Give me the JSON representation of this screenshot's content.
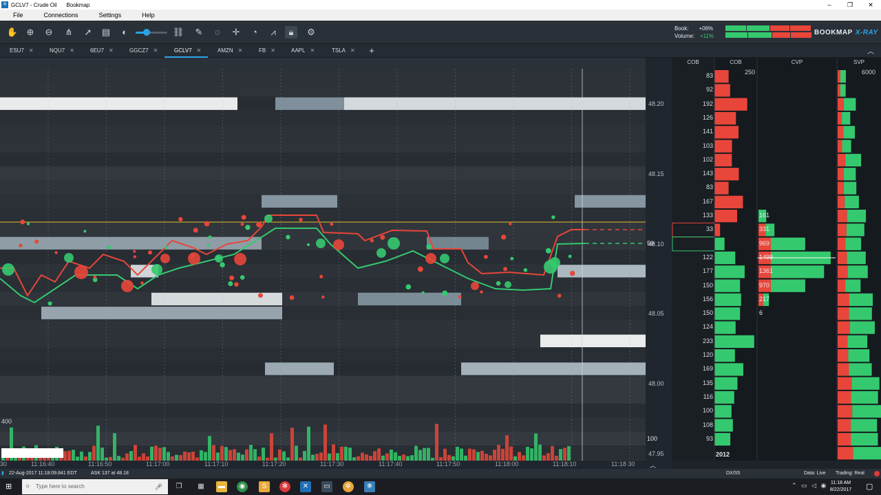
{
  "window": {
    "title": "GCLV7 - Crude Oil",
    "app": "Bookmap",
    "minimize": "–",
    "maximize": "❐",
    "close": "✕"
  },
  "menu": [
    "File",
    "Connections",
    "Settings",
    "Help"
  ],
  "toolbar": {
    "icons": [
      "hand-icon",
      "zoom-in-icon",
      "zoom-out-icon",
      "share-icon",
      "rocket-icon",
      "layers-icon",
      "brightness-icon",
      "link-icon",
      "pencil-icon",
      "chat-icon",
      "crosshair-icon",
      "timer-icon",
      "line-chart-icon",
      "lock-icon",
      "gear-icon"
    ],
    "slider_value": 0.35
  },
  "stats": {
    "book_label": "Book:",
    "book_value": "+06%",
    "volume_label": "Volume:",
    "volume_value": "+11%"
  },
  "brand": {
    "name": "BOOKMAP",
    "suffix": "X-RAY"
  },
  "tabs": [
    {
      "label": "ESU7",
      "close": "✕"
    },
    {
      "label": "NQU7",
      "close": "✕"
    },
    {
      "label": "6EU7",
      "close": "✕"
    },
    {
      "label": "GGCZ7",
      "close": "✕"
    },
    {
      "label": "GCLV7",
      "close": "✕",
      "active": true
    },
    {
      "label": "AMZN",
      "close": "✕"
    },
    {
      "label": "FB",
      "close": "✕"
    },
    {
      "label": "AAPL",
      "close": "✕"
    },
    {
      "label": "TSLA",
      "close": "✕"
    }
  ],
  "add_tab": "+",
  "price_axis": {
    "labels": [
      "48.20",
      "48.15",
      "48.10",
      "48.05",
      "48.00",
      "47.95"
    ],
    "current": "59",
    "cob_last": "100"
  },
  "panels": {
    "headers": [
      "COB",
      "COB",
      "CVP",
      "SVP"
    ],
    "cob_scale": "250",
    "svp_scale": "6000",
    "asks": [
      "83",
      "92",
      "192",
      "126",
      "141",
      "103",
      "102",
      "143",
      "83",
      "167",
      "133",
      "33"
    ],
    "bids": [
      "122",
      "177",
      "150",
      "156",
      "150",
      "124",
      "233",
      "120",
      "169",
      "135",
      "116",
      "100",
      "108",
      "93"
    ],
    "cvp_values": [
      "161",
      "331",
      "969",
      "1499",
      "1361",
      "970",
      "217",
      "6"
    ],
    "cob_total": "2012"
  },
  "volume": {
    "scale_label": "400"
  },
  "time_axis": [
    "30",
    "11:16:40",
    "11:16:50",
    "11:17:00",
    "11:17:10",
    "11:17:20",
    "11:17:30",
    "11:17:40",
    "11:17:50",
    "11:18:00",
    "11:18:10",
    "11:18 30"
  ],
  "status": {
    "datetime": "22-Aug-2017 11:18:09.841 EDT",
    "ask": "ASK 137 at 48.18",
    "feed": "DX/S5",
    "data": "Data: Live",
    "trading": "Trading: Real"
  },
  "taskbar": {
    "search_placeholder": "Type here to search",
    "time": "11:18 AM",
    "date": "8/22/2017"
  },
  "colors": {
    "accent": "#2aa4e8",
    "buy": "#35c96f",
    "sell": "#e8463a"
  }
}
